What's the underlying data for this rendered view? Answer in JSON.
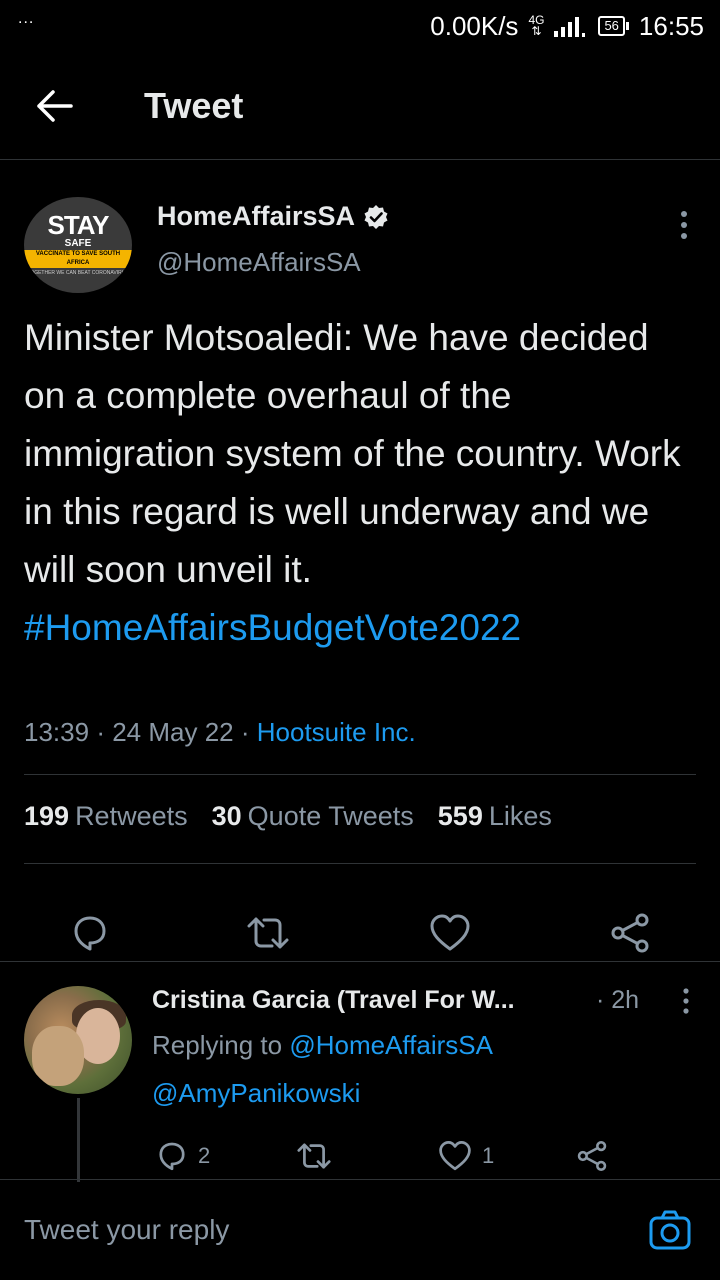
{
  "statusbar": {
    "dots": "...",
    "speed": "0.00K/s",
    "network": "4G",
    "battery": "56",
    "time": "16:55"
  },
  "header": {
    "title": "Tweet"
  },
  "tweet": {
    "avatar_text": {
      "line1": "STAY",
      "line2": "SAFE",
      "line3": "VACCINATE TO SAVE SOUTH AFRICA",
      "line4": "TOGETHER WE CAN BEAT CORONAVIRUS"
    },
    "author_name": "HomeAffairsSA",
    "author_handle": "@HomeAffairsSA",
    "text": "Minister Motsoaledi: We have decided on a complete overhaul of the immigration system of the country. Work in this regard is well underway and we will soon unveil it.",
    "hashtag": "#HomeAffairsBudgetVote2022",
    "time": "13:39",
    "date": "24 May 22",
    "source": "Hootsuite Inc.",
    "separator": "·",
    "stats": {
      "retweets_count": "199",
      "retweets_label": "Retweets",
      "quotes_count": "30",
      "quotes_label": "Quote Tweets",
      "likes_count": "559",
      "likes_label": "Likes"
    }
  },
  "reply": {
    "name": "Cristina Garcia (Travel For W...",
    "time": "· 2h",
    "replying_prefix": "Replying to ",
    "replying_to": "@HomeAffairsSA",
    "text": "@AmyPanikowski",
    "reply_count": "2",
    "like_count": "1"
  },
  "composer": {
    "placeholder": "Tweet your reply"
  },
  "colors": {
    "background": "#000000",
    "accent": "#1d9bf0",
    "secondary_text": "#8b98a5",
    "divider": "#2f3336"
  }
}
